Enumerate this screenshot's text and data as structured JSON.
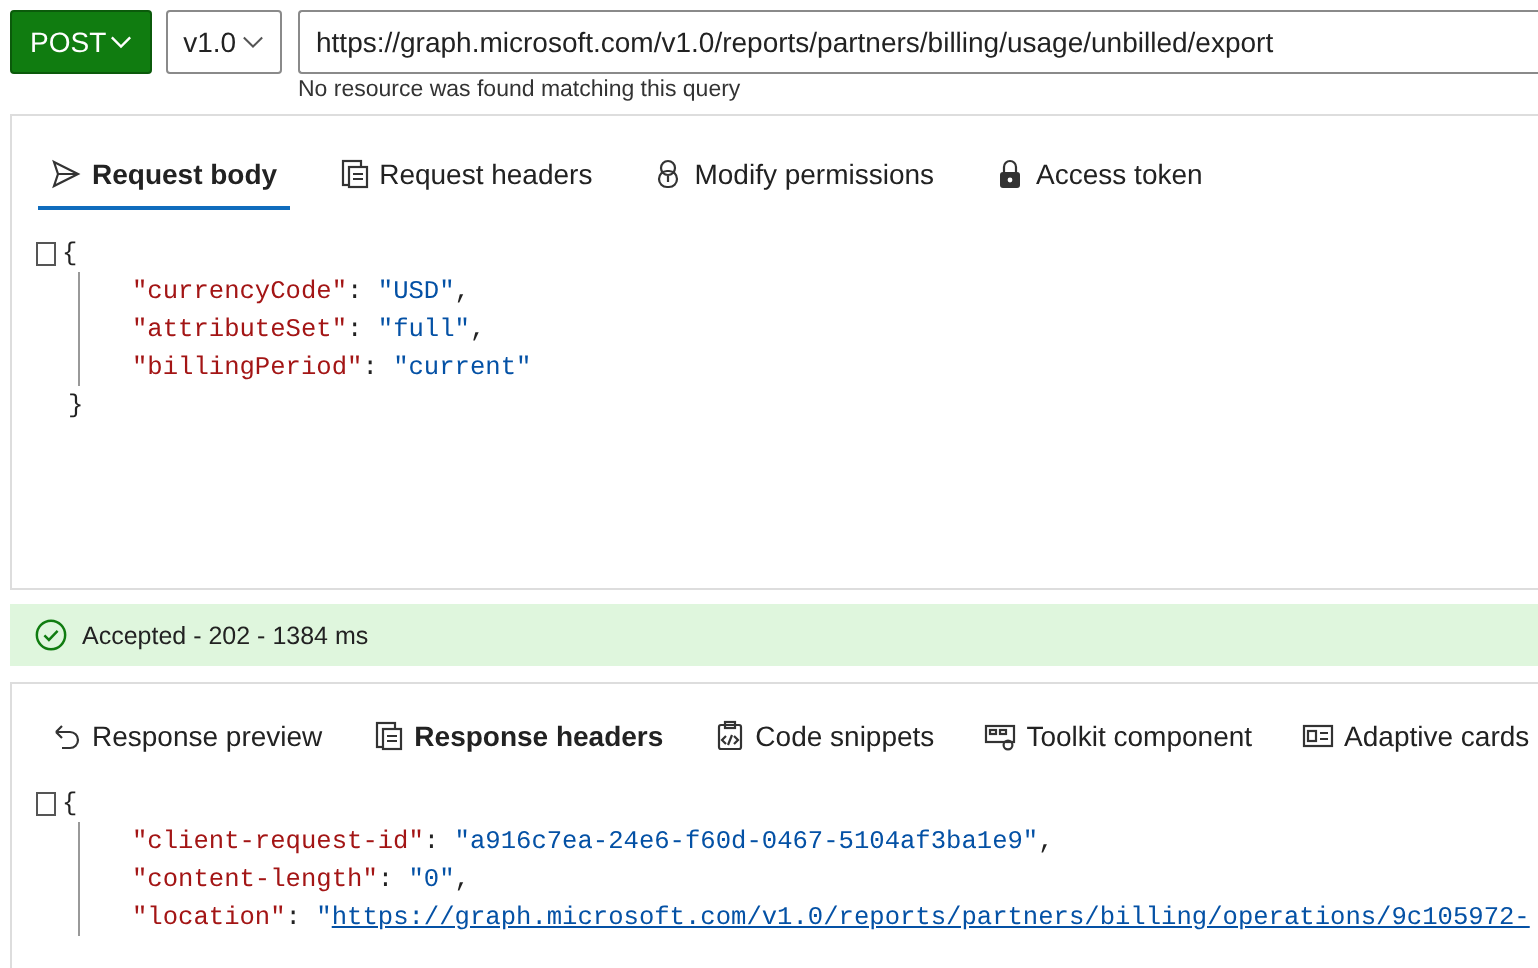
{
  "query": {
    "method": "POST",
    "version": "v1.0",
    "url": "https://graph.microsoft.com/v1.0/reports/partners/billing/usage/unbilled/export",
    "hint": "No resource was found matching this query"
  },
  "request": {
    "tabs": [
      {
        "label": "Request body",
        "selected": true
      },
      {
        "label": "Request headers",
        "selected": false
      },
      {
        "label": "Modify permissions",
        "selected": false
      },
      {
        "label": "Access token",
        "selected": false
      }
    ],
    "body": {
      "open": "{",
      "close": "}",
      "lines": [
        {
          "key": "\"currencyCode\"",
          "sep": ":",
          "value": "\"USD\"",
          "end": ",",
          "kind": "string"
        },
        {
          "key": "\"attributeSet\"",
          "sep": ":",
          "value": "\"full\"",
          "end": ",",
          "kind": "string"
        },
        {
          "key": "\"billingPeriod\"",
          "sep": ":",
          "value": "\"current\"",
          "kind": "string"
        }
      ]
    }
  },
  "status": {
    "text": "Accepted - 202 - 1384 ms"
  },
  "response": {
    "tabs": [
      {
        "label": "Response preview",
        "selected": false
      },
      {
        "label": "Response headers",
        "selected": true
      },
      {
        "label": "Code snippets",
        "selected": false
      },
      {
        "label": "Toolkit component",
        "selected": false
      },
      {
        "label": "Adaptive cards",
        "selected": false
      }
    ],
    "body": {
      "open": "{",
      "lines": [
        {
          "key": "\"client-request-id\"",
          "sep": ":",
          "value": "\"a916c7ea-24e6-f60d-0467-5104af3ba1e9\"",
          "end": ",",
          "kind": "string"
        },
        {
          "key": "\"content-length\"",
          "sep": ":",
          "value": "\"0\"",
          "end": ",",
          "kind": "string"
        },
        {
          "key": "\"location\"",
          "sep": ":",
          "value": "\"",
          "link": "https://graph.microsoft.com/v1.0/reports/partners/billing/operations/9c105972-",
          "kind": "link"
        }
      ]
    }
  }
}
